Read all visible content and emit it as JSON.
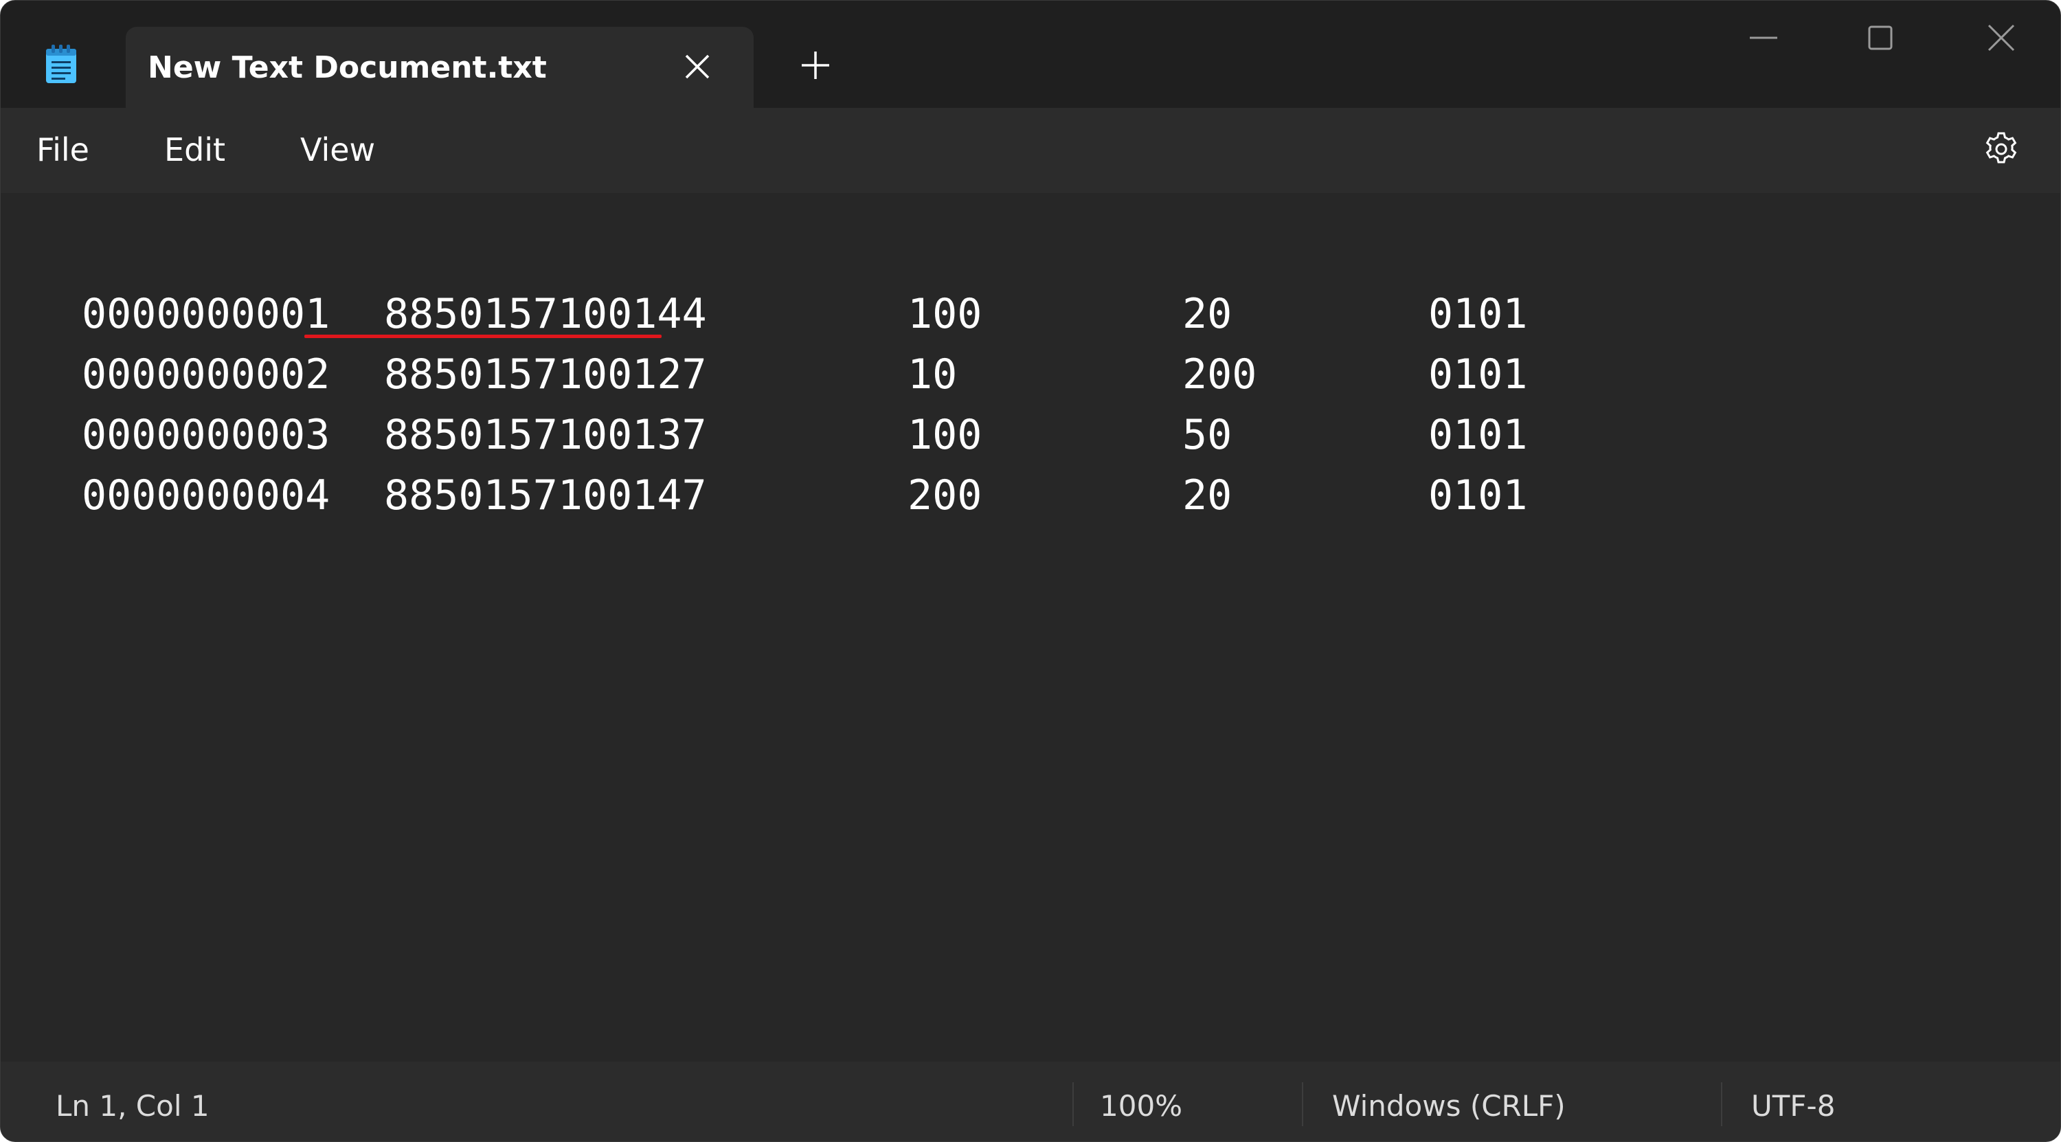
{
  "window": {
    "tab_title": "New Text Document.txt",
    "app_icon": "notepad-icon",
    "controls": {
      "new_tab_icon": "plus-icon",
      "tab_close_icon": "close-icon",
      "minimize_icon": "minimize-icon",
      "maximize_icon": "maximize-icon",
      "close_icon": "close-icon"
    }
  },
  "menu": {
    "file": "File",
    "edit": "Edit",
    "view": "View",
    "settings_icon": "gear-icon"
  },
  "editor": {
    "lines": [
      [
        "0000000001",
        "8850157100144",
        "100",
        "20",
        "0101"
      ],
      [
        "0000000002",
        "8850157100127",
        "10",
        "200",
        "0101"
      ],
      [
        "0000000003",
        "8850157100137",
        "100",
        "50",
        "0101"
      ],
      [
        "0000000004",
        "8850157100147",
        "200",
        "20",
        "0101"
      ]
    ],
    "spellcheck_flagged": "8850157100144"
  },
  "status": {
    "position": "Ln 1, Col 1",
    "zoom": "100%",
    "line_ending": "Windows (CRLF)",
    "encoding": "UTF-8"
  },
  "colors": {
    "background": "#272727",
    "titlebar": "#1f1f1f",
    "bars": "#2c2c2c",
    "text": "#ffffff",
    "spellcheck": "#e0161c",
    "icon_accent": "#4cc2ff"
  }
}
